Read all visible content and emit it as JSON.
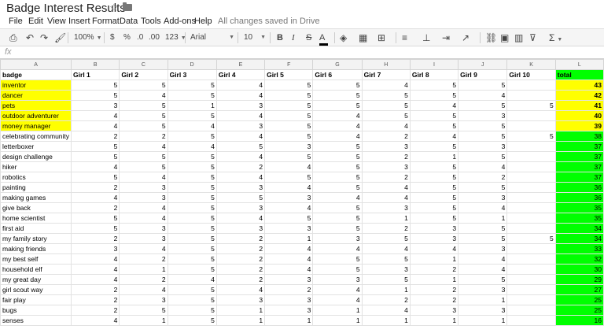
{
  "app": {
    "doc_title": "Badge Interest Results",
    "save_status": "All changes saved in Drive"
  },
  "menu": [
    "File",
    "Edit",
    "View",
    "Insert",
    "Format",
    "Data",
    "Tools",
    "Add-ons",
    "Help"
  ],
  "toolbar": {
    "zoom": "100%",
    "currency": "$",
    "percent": "%",
    "decrease_decimals": ".0",
    "increase_decimals": ".00",
    "more_formats": "123",
    "font": "Arial",
    "font_size": "10",
    "bold": "B",
    "italic": "I",
    "strikethrough": "S",
    "text_color": "A",
    "functions": "Σ"
  },
  "formula_bar": {
    "fx": "fx",
    "value": ""
  },
  "grid": {
    "column_letters": [
      "A",
      "B",
      "C",
      "D",
      "E",
      "F",
      "G",
      "H",
      "I",
      "J",
      "K",
      "L"
    ],
    "header": [
      "badge",
      "Girl 1",
      "Girl 2",
      "Girl 3",
      "Girl 4",
      "Girl 5",
      "Girl 6",
      "Girl 7",
      "Girl 8",
      "Girl 9",
      "Girl 10",
      "total"
    ],
    "rows": [
      {
        "badge": "inventor",
        "vals": [
          "5",
          "5",
          "5",
          "4",
          "5",
          "5",
          "4",
          "5",
          "5",
          ""
        ],
        "total": "43",
        "hl": true
      },
      {
        "badge": "dancer",
        "vals": [
          "5",
          "4",
          "5",
          "4",
          "5",
          "5",
          "5",
          "5",
          "4",
          ""
        ],
        "total": "42",
        "hl": true
      },
      {
        "badge": "pets",
        "vals": [
          "3",
          "5",
          "1",
          "3",
          "5",
          "5",
          "5",
          "4",
          "5",
          "5"
        ],
        "total": "41",
        "hl": true
      },
      {
        "badge": "outdoor adventurer",
        "vals": [
          "4",
          "5",
          "5",
          "4",
          "5",
          "4",
          "5",
          "5",
          "3",
          ""
        ],
        "total": "40",
        "hl": true
      },
      {
        "badge": "money manager",
        "vals": [
          "4",
          "5",
          "4",
          "3",
          "5",
          "4",
          "4",
          "5",
          "5",
          ""
        ],
        "total": "39",
        "hl": true
      },
      {
        "badge": "celebrating community",
        "vals": [
          "2",
          "2",
          "5",
          "4",
          "5",
          "4",
          "2",
          "4",
          "5",
          "5"
        ],
        "total": "38",
        "hl": false
      },
      {
        "badge": "letterboxer",
        "vals": [
          "5",
          "4",
          "4",
          "5",
          "3",
          "5",
          "3",
          "5",
          "3",
          ""
        ],
        "total": "37",
        "hl": false
      },
      {
        "badge": "design challenge",
        "vals": [
          "5",
          "5",
          "5",
          "4",
          "5",
          "5",
          "2",
          "1",
          "5",
          ""
        ],
        "total": "37",
        "hl": false
      },
      {
        "badge": "hiker",
        "vals": [
          "4",
          "5",
          "5",
          "2",
          "4",
          "5",
          "3",
          "5",
          "4",
          ""
        ],
        "total": "37",
        "hl": false
      },
      {
        "badge": "robotics",
        "vals": [
          "5",
          "4",
          "5",
          "4",
          "5",
          "5",
          "2",
          "5",
          "2",
          ""
        ],
        "total": "37",
        "hl": false
      },
      {
        "badge": "painting",
        "vals": [
          "2",
          "3",
          "5",
          "3",
          "4",
          "5",
          "4",
          "5",
          "5",
          ""
        ],
        "total": "36",
        "hl": false
      },
      {
        "badge": "making games",
        "vals": [
          "4",
          "3",
          "5",
          "5",
          "3",
          "4",
          "4",
          "5",
          "3",
          ""
        ],
        "total": "36",
        "hl": false
      },
      {
        "badge": "give back",
        "vals": [
          "2",
          "4",
          "5",
          "3",
          "4",
          "5",
          "3",
          "5",
          "4",
          ""
        ],
        "total": "35",
        "hl": false
      },
      {
        "badge": "home scientist",
        "vals": [
          "5",
          "4",
          "5",
          "4",
          "5",
          "5",
          "1",
          "5",
          "1",
          ""
        ],
        "total": "35",
        "hl": false
      },
      {
        "badge": "first aid",
        "vals": [
          "5",
          "3",
          "5",
          "3",
          "3",
          "5",
          "2",
          "3",
          "5",
          ""
        ],
        "total": "34",
        "hl": false
      },
      {
        "badge": "my family story",
        "vals": [
          "2",
          "3",
          "5",
          "2",
          "1",
          "3",
          "5",
          "3",
          "5",
          "5"
        ],
        "total": "34",
        "hl": false
      },
      {
        "badge": "making friends",
        "vals": [
          "3",
          "4",
          "5",
          "2",
          "4",
          "4",
          "4",
          "4",
          "3",
          ""
        ],
        "total": "33",
        "hl": false
      },
      {
        "badge": "my best self",
        "vals": [
          "4",
          "2",
          "5",
          "2",
          "4",
          "5",
          "5",
          "1",
          "4",
          ""
        ],
        "total": "32",
        "hl": false
      },
      {
        "badge": "household elf",
        "vals": [
          "4",
          "1",
          "5",
          "2",
          "4",
          "5",
          "3",
          "2",
          "4",
          ""
        ],
        "total": "30",
        "hl": false
      },
      {
        "badge": "my great day",
        "vals": [
          "4",
          "2",
          "4",
          "2",
          "3",
          "3",
          "5",
          "1",
          "5",
          ""
        ],
        "total": "29",
        "hl": false
      },
      {
        "badge": "girl scout way",
        "vals": [
          "2",
          "4",
          "5",
          "4",
          "2",
          "4",
          "1",
          "2",
          "3",
          ""
        ],
        "total": "27",
        "hl": false
      },
      {
        "badge": "fair play",
        "vals": [
          "2",
          "3",
          "5",
          "3",
          "3",
          "4",
          "2",
          "2",
          "1",
          ""
        ],
        "total": "25",
        "hl": false
      },
      {
        "badge": "bugs",
        "vals": [
          "2",
          "5",
          "5",
          "1",
          "3",
          "1",
          "4",
          "3",
          "3",
          ""
        ],
        "total": "25",
        "hl": false
      },
      {
        "badge": "senses",
        "vals": [
          "4",
          "1",
          "5",
          "1",
          "1",
          "1",
          "1",
          "1",
          "1",
          ""
        ],
        "total": "16",
        "hl": false
      }
    ]
  }
}
